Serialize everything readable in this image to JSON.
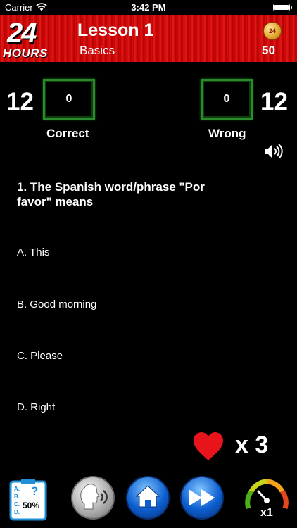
{
  "status_bar": {
    "carrier": "Carrier",
    "time": "3:42 PM"
  },
  "header": {
    "logo_number": "24",
    "logo_text": "HOURS",
    "lesson_title": "Lesson 1",
    "lesson_subtitle": "Basics",
    "coins": "50"
  },
  "score": {
    "correct_remaining": "12",
    "correct_count": "0",
    "correct_label": "Correct",
    "wrong_count": "0",
    "wrong_remaining": "12",
    "wrong_label": "Wrong"
  },
  "question": {
    "text": "1. The Spanish word/phrase \"Por favor\" means",
    "options": [
      "A. This",
      "B. Good morning",
      "C. Please",
      "D. Right"
    ]
  },
  "lives": {
    "label": "x 3"
  },
  "bottom_bar": {
    "hint_label": "50%",
    "speed_label": "x1"
  },
  "icons": {
    "wifi": "wifi-icon",
    "battery": "battery-icon",
    "coin": "coin-icon",
    "speaker": "speaker-icon",
    "heart": "heart-icon",
    "hint": "clipboard-quiz-icon",
    "speak": "speaking-head-icon",
    "home": "home-icon",
    "skip": "fast-forward-icon",
    "speed": "speedometer-icon"
  },
  "colors": {
    "header_red": "#d90d0d",
    "score_box_border": "#2b8a2b",
    "heart_red": "#e8141c",
    "button_blue": "#0d5fd0"
  }
}
